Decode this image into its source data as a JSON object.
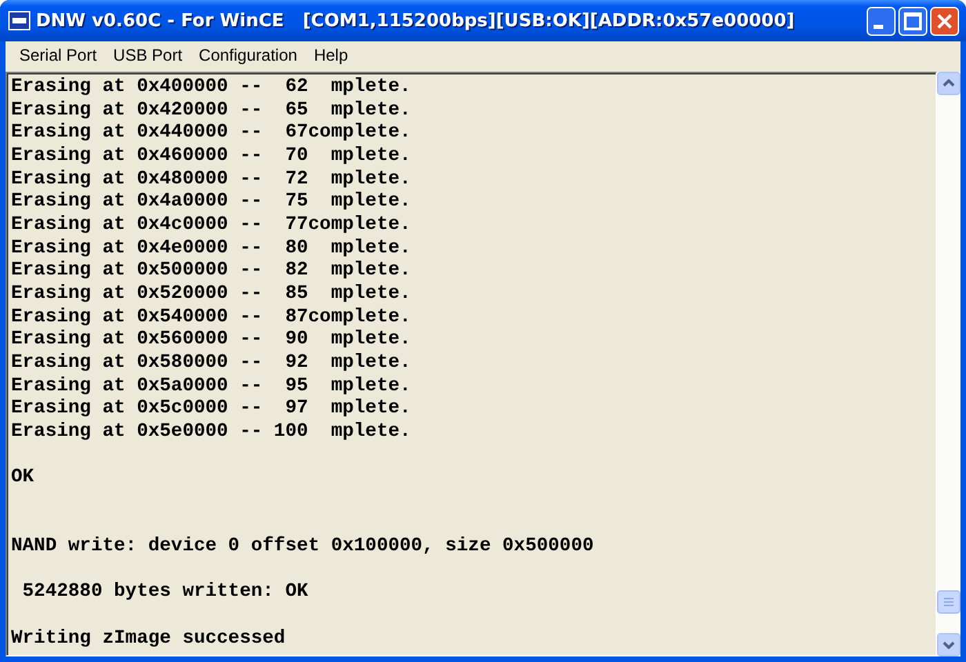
{
  "window": {
    "title": "DNW v0.60C - For WinCE   [COM1,115200bps][USB:OK][ADDR:0x57e00000]"
  },
  "menu": [
    "Serial Port",
    "USB Port",
    "Configuration",
    "Help"
  ],
  "console": {
    "lines": [
      {
        "kind": "text",
        "text": "Erasing at 0x400000 --  62  mplete."
      },
      {
        "kind": "text",
        "text": "Erasing at 0x420000 --  65  mplete."
      },
      {
        "kind": "text",
        "text": "Erasing at 0x440000 --  67complete."
      },
      {
        "kind": "text",
        "text": "Erasing at 0x460000 --  70  mplete."
      },
      {
        "kind": "text",
        "text": "Erasing at 0x480000 --  72  mplete."
      },
      {
        "kind": "text",
        "text": "Erasing at 0x4a0000 --  75  mplete."
      },
      {
        "kind": "text",
        "text": "Erasing at 0x4c0000 --  77complete."
      },
      {
        "kind": "text",
        "text": "Erasing at 0x4e0000 --  80  mplete."
      },
      {
        "kind": "text",
        "text": "Erasing at 0x500000 --  82  mplete."
      },
      {
        "kind": "text",
        "text": "Erasing at 0x520000 --  85  mplete."
      },
      {
        "kind": "text",
        "text": "Erasing at 0x540000 --  87complete."
      },
      {
        "kind": "text",
        "text": "Erasing at 0x560000 --  90  mplete."
      },
      {
        "kind": "text",
        "text": "Erasing at 0x580000 --  92  mplete."
      },
      {
        "kind": "text",
        "text": "Erasing at 0x5a0000 --  95  mplete."
      },
      {
        "kind": "text",
        "text": "Erasing at 0x5c0000 --  97  mplete."
      },
      {
        "kind": "text",
        "text": "Erasing at 0x5e0000 -- 100  mplete."
      },
      {
        "kind": "blank"
      },
      {
        "kind": "text",
        "text": "OK"
      },
      {
        "kind": "blank"
      },
      {
        "kind": "blank"
      },
      {
        "kind": "text",
        "text": "NAND write: device 0 offset 0x100000, size 0x500000"
      },
      {
        "kind": "blank"
      },
      {
        "kind": "text",
        "text": " 5242880 bytes written: OK"
      },
      {
        "kind": "blank"
      },
      {
        "kind": "text",
        "text": "Writing zImage successed"
      }
    ]
  }
}
